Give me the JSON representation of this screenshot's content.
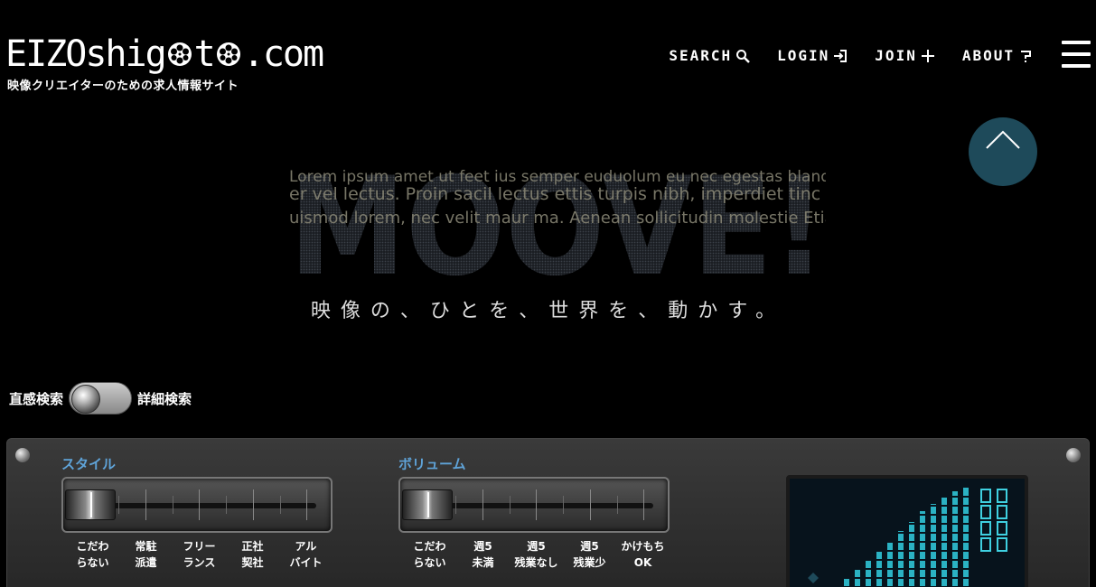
{
  "header": {
    "logo_left": "EIZOshig",
    "logo_mid": "t",
    "logo_right": ".com",
    "tagline": "映像クリエイターのための求人情報サイト"
  },
  "nav": [
    {
      "label": "SEARCH",
      "icon": "search-icon"
    },
    {
      "label": "LOGIN",
      "icon": "login-icon"
    },
    {
      "label": "JOIN",
      "icon": "plus-icon"
    },
    {
      "label": "ABOUT",
      "icon": "question-icon"
    }
  ],
  "hero": {
    "title": "MOOVE!",
    "tagline": "映像の、ひとを、世界を、動かす。"
  },
  "search_toggle": {
    "left_label": "直感検索",
    "right_label": "詳細検索",
    "state": "直感検索"
  },
  "panel": {
    "style": {
      "title": "スタイル",
      "options": [
        {
          "line1": "こだわ",
          "line2": "らない"
        },
        {
          "line1": "常駐",
          "line2": "派遣"
        },
        {
          "line1": "フリー",
          "line2": "ランス"
        },
        {
          "line1": "正社",
          "line2": "契社"
        },
        {
          "line1": "アル",
          "line2": "バイト"
        }
      ],
      "selected": "こだわらない"
    },
    "volume": {
      "title": "ボリューム",
      "options": [
        {
          "line1": "こだわ",
          "line2": "らない"
        },
        {
          "line1": "週5",
          "line2": "未満"
        },
        {
          "line1": "週5",
          "line2": "残業なし"
        },
        {
          "line1": "週5",
          "line2": "残業少"
        },
        {
          "line1": "かけもち",
          "line2": "OK"
        }
      ],
      "selected": "こだわらない"
    }
  },
  "colors": {
    "accent": "#5fa3d8",
    "background": "#000000",
    "panel": "#303030",
    "display_glow": "#3fd0e0"
  }
}
